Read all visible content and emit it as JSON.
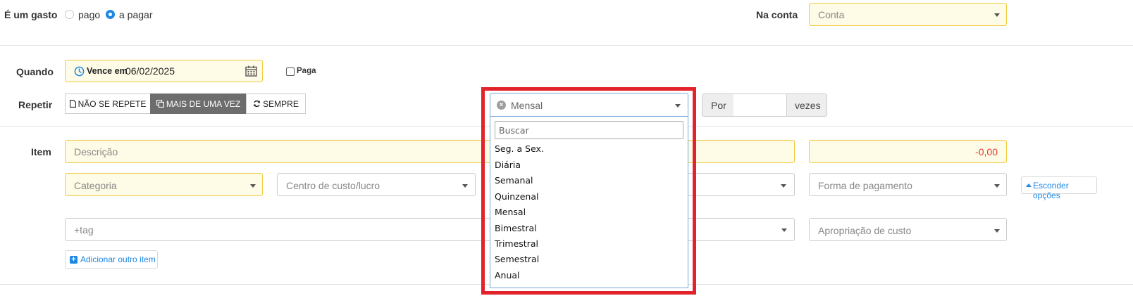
{
  "expense": {
    "label": "É um gasto",
    "options": [
      "pago",
      "a pagar"
    ],
    "selected": "a pagar"
  },
  "account": {
    "label": "Na conta",
    "placeholder": "Conta"
  },
  "when": {
    "label": "Quando",
    "due_prefix": "Vence em",
    "date": "06/02/2025",
    "paid_label": "Paga"
  },
  "repeat": {
    "label": "Repetir",
    "buttons": [
      "NÃO SE REPETE",
      "MAIS DE UMA VEZ",
      "SEMPRE"
    ],
    "active": "MAIS DE UMA VEZ",
    "frequency_value": "Mensal",
    "search_placeholder": "Buscar",
    "frequency_options": [
      "Seg. a Sex.",
      "Diária",
      "Semanal",
      "Quinzenal",
      "Mensal",
      "Bimestral",
      "Trimestral",
      "Semestral",
      "Anual"
    ],
    "por_label": "Por",
    "times_value": "",
    "vezes_label": "vezes"
  },
  "item": {
    "label": "Item",
    "description_placeholder": "Descrição",
    "amount": "-0,00",
    "category_placeholder": "Categoria",
    "cost_center_placeholder": "Centro de custo/lucro",
    "payment_method_placeholder": "Forma de pagamento",
    "hide_options_label": "Esconder opções",
    "tag_placeholder": "+tag",
    "cost_allocation_placeholder": "Apropriação de custo",
    "add_item_label": "Adicionar outro item"
  },
  "colors": {
    "highlight_border": "#e3232b",
    "field_yellow_bg": "#fefbe6",
    "field_yellow_border": "#f0c93e",
    "accent_blue": "#1e88e5",
    "amount_red": "#e53935"
  }
}
